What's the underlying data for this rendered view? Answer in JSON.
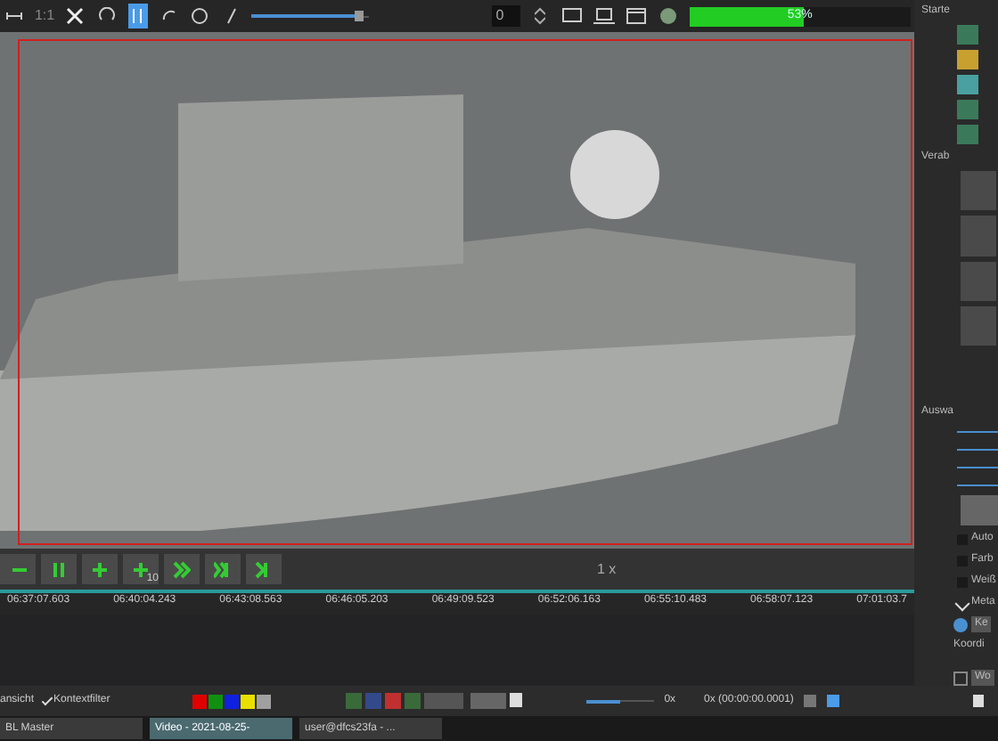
{
  "toolbar": {
    "zoom_label": "1:1",
    "zoom_slider": {
      "level": 0.95
    },
    "frame_field": "0",
    "progress": {
      "level": 0.52,
      "reading": "53%"
    }
  },
  "video": {
    "region_box": true
  },
  "controls": {
    "speed": "1 x",
    "buttons": [
      {
        "kind": "back"
      },
      {
        "kind": "pause"
      },
      {
        "kind": "step"
      },
      {
        "kind": "step10",
        "label": "10"
      },
      {
        "kind": "forward"
      },
      {
        "kind": "fast"
      },
      {
        "kind": "end"
      }
    ]
  },
  "timeline": {
    "ticks": [
      "06:37:07.603",
      "06:40:04.243",
      "06:43:08.563",
      "06:46:05.203",
      "06:49:09.523",
      "06:52:06.163",
      "06:55:10.483",
      "06:58:07.123",
      "07:01:03.7"
    ]
  },
  "side_panel": {
    "start_label": "Starte",
    "section_label": "Verab",
    "select_label": "Auswa",
    "options": [
      {
        "label": "Auto",
        "checked": false
      },
      {
        "label": "Farb",
        "checked": false
      },
      {
        "label": "Weiß",
        "checked": false
      },
      {
        "label": "Meta",
        "checked": true
      }
    ],
    "key_button": "Ke",
    "coords_label": "Koordi",
    "world_button": "Wo"
  },
  "bottom_bar": {
    "view_label": "ansicht",
    "context_filter": {
      "label": "Kontextfilter",
      "checked": true
    },
    "colors": [
      {
        "color": "#e00000"
      },
      {
        "color": "#109010"
      },
      {
        "color": "#1020e0"
      },
      {
        "color": "#e8e000"
      },
      {
        "color": "#a0a0a0"
      }
    ],
    "speed_slider": {
      "level": 0.5,
      "reading": "0x"
    },
    "time_reading": "0x (00:00:00.0001)"
  },
  "taskbar": [
    {
      "label": "BL Master",
      "selected": false
    },
    {
      "label": "Video - 2021-08-25-",
      "selected": true
    },
    {
      "label": "user@dfcs23fa - ...",
      "selected": false
    }
  ]
}
